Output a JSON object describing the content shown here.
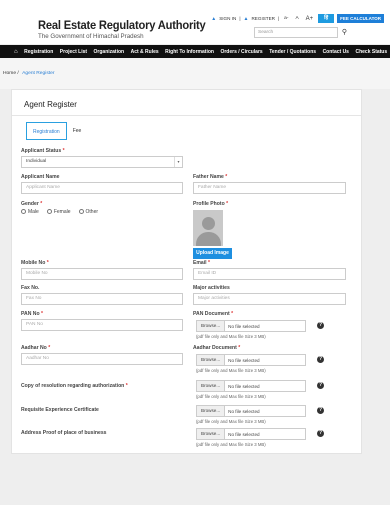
{
  "header": {
    "title": "Real Estate Regulatory Authority",
    "subtitle": "The Government of Himachal Pradesh",
    "links": {
      "signin": "SIGN IN",
      "register": "REGISTER",
      "font_small": "a-",
      "font_normal": "A",
      "font_large": "A+",
      "lang": "हिं",
      "fee": "FEE CALCULATOR"
    },
    "search_placeholder": "Search",
    "search_icon": "search-icon"
  },
  "nav": [
    "Registration",
    "Project List",
    "Organization",
    "Act & Rules",
    "Right To Information",
    "Orders / Circulars",
    "Tender / Quotations",
    "Contact Us",
    "Check Status"
  ],
  "breadcrumb": {
    "home": "Home",
    "current": "Agent Register"
  },
  "form": {
    "title": "Agent Register",
    "tabs": [
      "Registration",
      "Fee"
    ],
    "applicant_status": {
      "label": "Applicant Status",
      "value": "Individual"
    },
    "applicant_name": {
      "label": "Applicant Name",
      "placeholder": "Applicant Name"
    },
    "father_name": {
      "label": "Father Name",
      "placeholder": "Father Name"
    },
    "gender": {
      "label": "Gender",
      "options": [
        "Male",
        "Female",
        "Other"
      ]
    },
    "profile_photo": {
      "label": "Profile Photo",
      "button": "Upload Image"
    },
    "mobile": {
      "label": "Mobile No",
      "placeholder": "Mobile No"
    },
    "email": {
      "label": "Email",
      "placeholder": "Email ID"
    },
    "fax": {
      "label": "Fax No.",
      "placeholder": "Fax No"
    },
    "major": {
      "label": "Major activities",
      "placeholder": "Major activities"
    },
    "pan": {
      "label": "PAN No",
      "placeholder": "PAN No"
    },
    "pan_doc": {
      "label": "PAN Document"
    },
    "aadhar": {
      "label": "Aadhar No",
      "placeholder": "Aadhar No"
    },
    "aadhar_doc": {
      "label": "Aadhar Document"
    },
    "resolution": {
      "label": "Copy of resolution regarding authorization"
    },
    "experience": {
      "label": "Requisite Experience Certificate"
    },
    "address": {
      "label": "Address Proof of place of business"
    },
    "file": {
      "browse": "Browse...",
      "none": "No file selected",
      "hint": "(pdf file only and Max file Size 3 MB)"
    }
  }
}
